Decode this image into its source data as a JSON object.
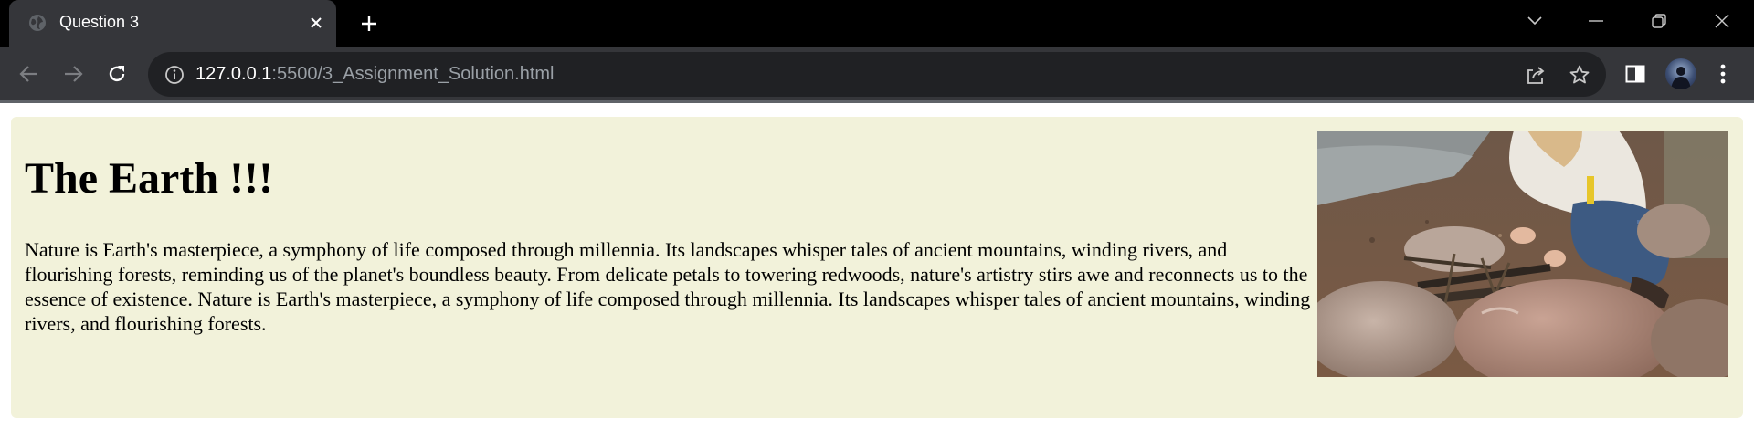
{
  "browser": {
    "tab": {
      "title": "Question 3",
      "favicon": "globe-icon"
    },
    "url": {
      "host": "127.0.0.1",
      "rest": ":5500/3_Assignment_Solution.html"
    },
    "icons": {
      "back": "arrow-left-icon",
      "forward": "arrow-right-icon",
      "reload": "reload-icon",
      "info": "info-icon",
      "share": "share-icon",
      "bookmark": "star-icon",
      "side_panel": "side-panel-icon",
      "menu": "kebab-menu-icon"
    }
  },
  "page": {
    "heading": "The Earth !!!",
    "paragraph": "Nature is Earth's masterpiece, a symphony of life composed through millennia. Its landscapes whisper tales of ancient mountains, winding rivers, and flourishing forests, reminding us of the planet's boundless beauty. From delicate petals to towering redwoods, nature's artistry stirs awe and reconnects us to the essence of existence. Nature is Earth's masterpiece, a symphony of life composed through millennia. Its landscapes whisper tales of ancient mountains, winding rivers, and flourishing forests.",
    "colors": {
      "card_background": "#f2f2da",
      "text": "#000000"
    }
  }
}
